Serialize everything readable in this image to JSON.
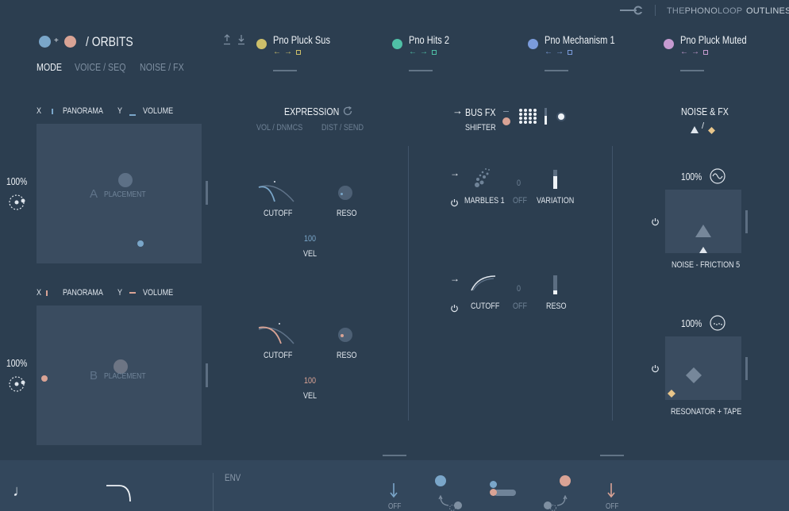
{
  "topbar": {
    "brand_the": "THE",
    "brand_phono": "PHONO",
    "brand_loop": "LOOP",
    "brand_product": "OUTLINES"
  },
  "header": {
    "plus": "+",
    "title": "/ ORBITS",
    "tabs": [
      {
        "label": "MODE",
        "active": true
      },
      {
        "label": "VOICE / SEQ",
        "active": false
      },
      {
        "label": "NOISE / FX",
        "active": false
      }
    ]
  },
  "slots": [
    {
      "name": "Pno Pluck Sus",
      "color": "#cdbf6a"
    },
    {
      "name": "Pno Hits 2",
      "color": "#4fc0a6"
    },
    {
      "name": "Pno Mechanism 1",
      "color": "#7b9cdc"
    },
    {
      "name": "Pno Pluck Muted",
      "color": "#c69ad0"
    }
  ],
  "orbits": {
    "a": {
      "x_label": "X",
      "x_param": "PANORAMA",
      "y_label": "Y",
      "y_param": "VOLUME",
      "letter": "A",
      "placement": "PLACEMENT",
      "percent": "100%",
      "color": "#7aa6c9"
    },
    "b": {
      "x_label": "X",
      "x_param": "PANORAMA",
      "y_label": "Y",
      "y_param": "VOLUME",
      "letter": "B",
      "placement": "PLACEMENT",
      "percent": "100%",
      "color": "#d9a395"
    }
  },
  "expression": {
    "title": "EXPRESSION",
    "sub_left": "VOL / DNMCS",
    "sub_right": "DIST / SEND",
    "a": {
      "cutoff": "CUTOFF",
      "reso": "RESO",
      "vel_value": "100",
      "vel": "VEL"
    },
    "b": {
      "cutoff": "CUTOFF",
      "reso": "RESO",
      "vel_value": "100",
      "vel": "VEL"
    }
  },
  "busfx": {
    "title": "BUS FX",
    "subtitle": "SHIFTER",
    "row1": {
      "name": "MARBLES 1",
      "off_value": "0",
      "off": "OFF",
      "param": "VARIATION"
    },
    "row2": {
      "name": "CUTOFF",
      "off_value": "0",
      "off": "OFF",
      "param": "RESO"
    }
  },
  "noisefx": {
    "title": "NOISE & FX",
    "slash": "/",
    "noise": {
      "percent": "100%",
      "name": "NOISE - FRICTION 5"
    },
    "resonator": {
      "percent": "100%",
      "name": "RESONATOR + TAPE"
    }
  },
  "bottom": {
    "env": "ENV",
    "off_left": "OFF",
    "off_right": "OFF"
  },
  "colors": {
    "bg": "#2c3e50",
    "pad": "#3a4c60",
    "orbit_a": "#7aa6c9",
    "orbit_b": "#d9a395"
  }
}
